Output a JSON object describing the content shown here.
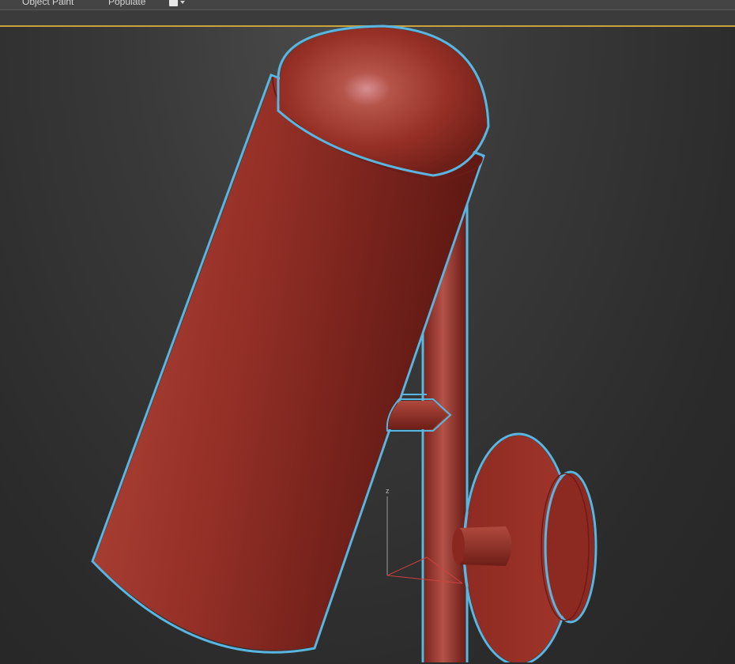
{
  "ribbon": {
    "tabs": [
      {
        "label": "Object Paint"
      },
      {
        "label": "Populate"
      }
    ]
  },
  "viewport": {
    "gizmo_axis_label": "z",
    "colors": {
      "model": "#9b3329",
      "selection_outline": "#5ab6e0",
      "active_border": "#c9a23a",
      "background": "#2f2f2f"
    }
  }
}
